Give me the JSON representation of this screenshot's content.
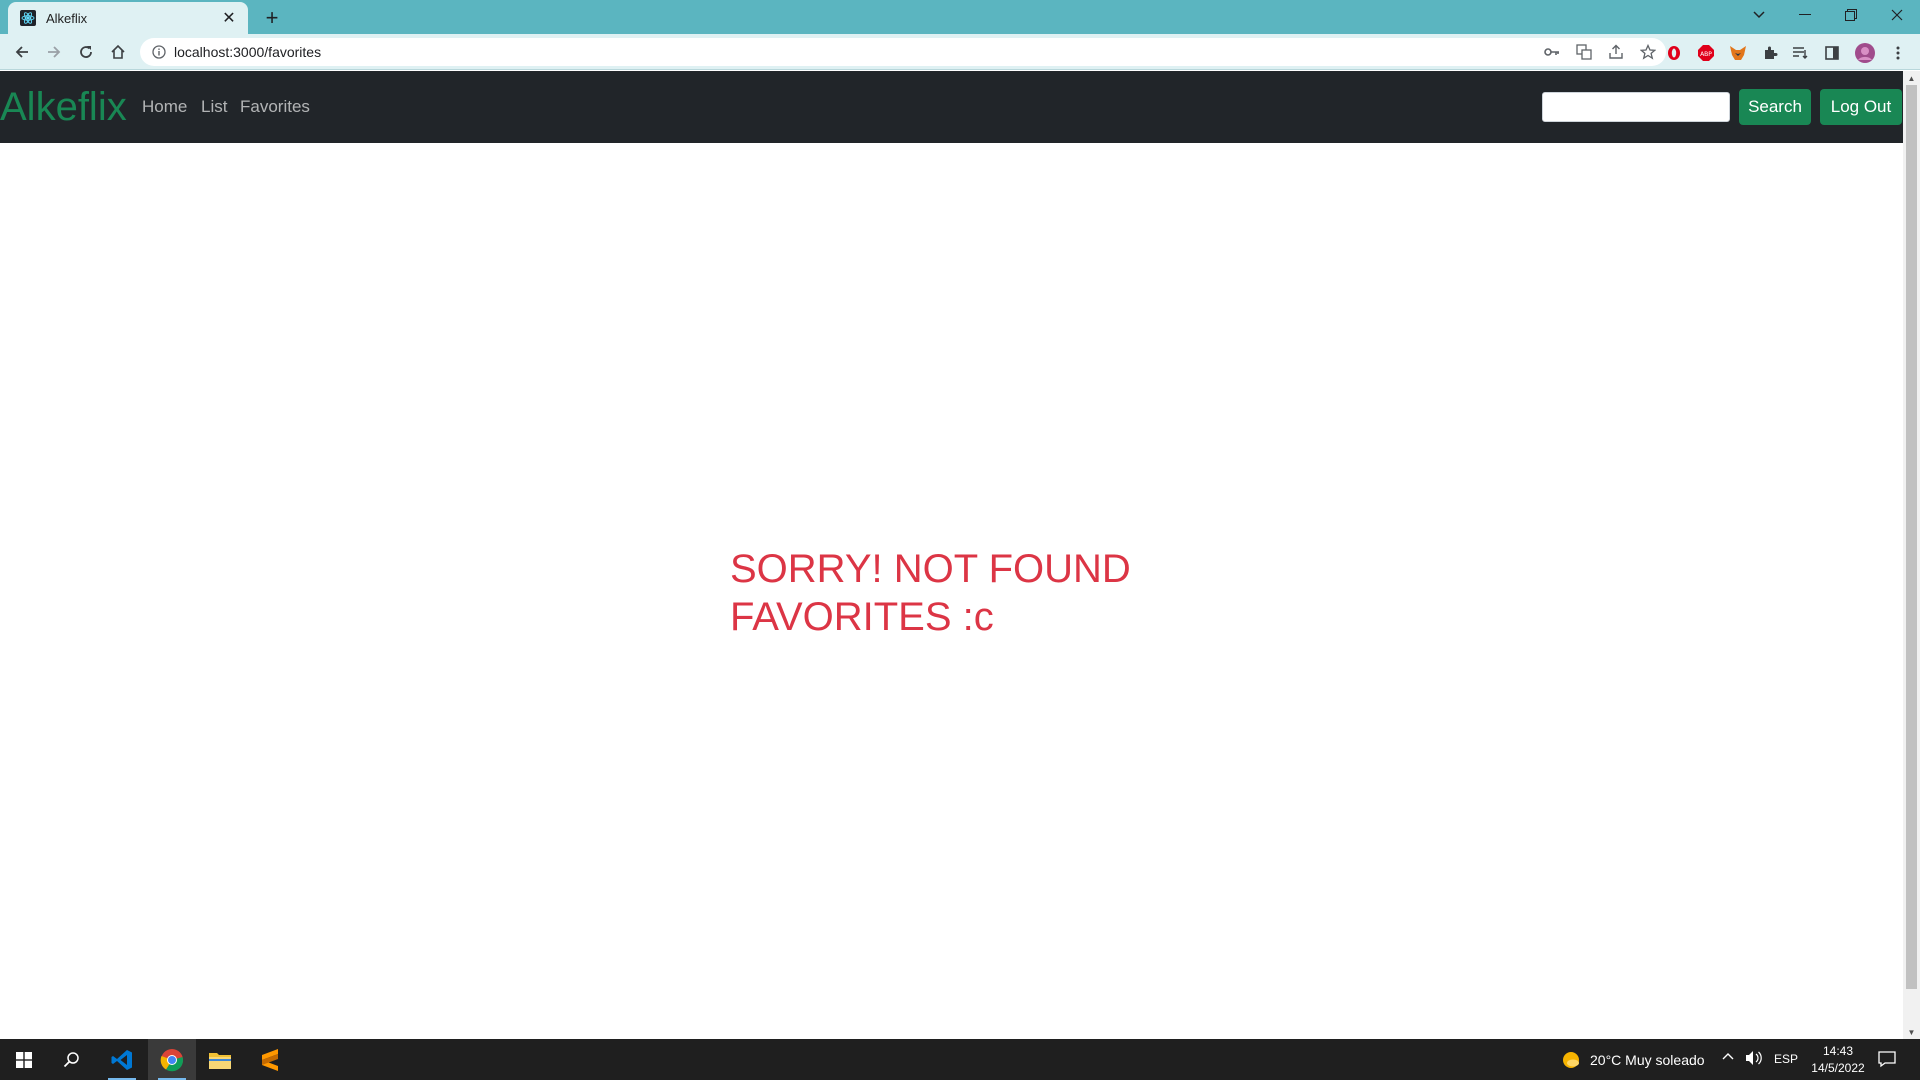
{
  "browser": {
    "tab_title": "Alkeflix",
    "url": "localhost:3000/favorites",
    "tab_close_glyph": "✕",
    "new_tab_glyph": "+"
  },
  "navbar": {
    "brand": "Alkeflix",
    "links": [
      "Home",
      "List",
      "Favorites"
    ],
    "search_placeholder": "",
    "search_button": "Search",
    "logout_button": "Log Out"
  },
  "main": {
    "message_line1": "SORRY! NOT FOUND",
    "message_line2": "FAVORITES :c"
  },
  "taskbar": {
    "weather": "20°C  Muy soleado",
    "language": "ESP",
    "time": "14:43",
    "date": "14/5/2022"
  },
  "colors": {
    "tabstrip": "#5bb5c0",
    "navbar_bg": "#212529",
    "brand_green": "#198754",
    "button_green": "#198754",
    "message_red": "#dc3545"
  }
}
